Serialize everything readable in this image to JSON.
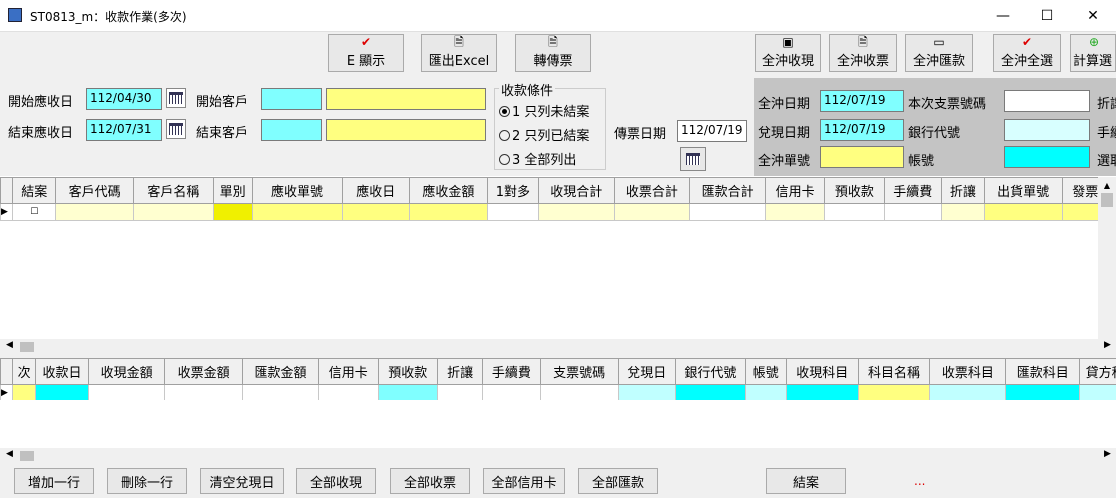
{
  "window": {
    "title": "ST0813_m：收款作業(多次)",
    "minimize": "—",
    "maximize": "☐",
    "close": "✕"
  },
  "toolbar": {
    "display": "E 顯示",
    "export_excel": "匯出Excel",
    "transfer": "轉傳票",
    "cash_all": "全沖收現",
    "note_all": "全沖收票",
    "remit_all": "全沖匯款",
    "select_all": "全沖全選",
    "calc": "計算選"
  },
  "filter": {
    "start_recv_date_label": "開始應收日",
    "start_recv_date": "112/04/30",
    "end_recv_date_label": "結束應收日",
    "end_recv_date": "112/07/31",
    "start_cust_label": "開始客戶",
    "start_cust_code": "",
    "start_cust_name": "",
    "end_cust_label": "結束客戶",
    "end_cust_code": "",
    "end_cust_name": "",
    "cond_title": "收款條件",
    "options": [
      "1 只列未結案",
      "2 只列已結案",
      "3 全部列出"
    ],
    "selected": 0,
    "voucher_date_label": "傳票日期",
    "voucher_date": "112/07/19"
  },
  "panel": {
    "offset_date_label": "全沖日期",
    "offset_date": "112/07/19",
    "cash_date_label": "兌現日期",
    "cash_date": "112/07/19",
    "offset_no_label": "全沖單號",
    "offset_no": "",
    "check_no_label": "本次支票號碼",
    "check_no": "",
    "bank_code_label": "銀行代號",
    "bank_code": "",
    "account_label": "帳號",
    "account": "",
    "cut_label_1": "折讓",
    "cut_label_2": "手續",
    "cut_label_3": "選取"
  },
  "grid1": {
    "headers": [
      "結案",
      "客戶代碼",
      "客戶名稱",
      "單別",
      "應收單號",
      "應收日",
      "應收金額",
      "1對多",
      "收現合計",
      "收票合計",
      "匯款合計",
      "信用卡",
      "預收款",
      "手續費",
      "折讓",
      "出貨單號",
      "發票號"
    ]
  },
  "grid2": {
    "headers": [
      "次",
      "收款日",
      "收現金額",
      "收票金額",
      "匯款金額",
      "信用卡",
      "預收款",
      "折讓",
      "手續費",
      "支票號碼",
      "兌現日",
      "銀行代號",
      "帳號",
      "收現科目",
      "科目名稱",
      "收票科目",
      "匯款科目",
      "貸方科目"
    ]
  },
  "bottom": {
    "add_row": "增加一行",
    "delete_row": "刪除一行",
    "clear_cash_date": "清空兌現日",
    "all_cash": "全部收現",
    "all_note": "全部收票",
    "all_card": "全部信用卡",
    "all_remit": "全部匯款",
    "close_case": "結案",
    "status": "..."
  },
  "colors": {
    "cyan": "#80ffff",
    "yellow": "#ffff80",
    "gray": "#c4c4c4",
    "check_red": "#dd0000"
  }
}
